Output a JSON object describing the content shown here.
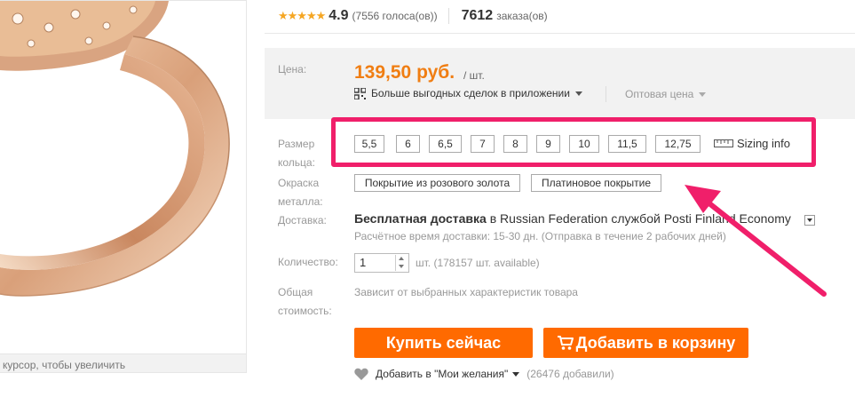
{
  "product_image": {
    "zoom_hint": "курсор, чтобы увеличить"
  },
  "rating": {
    "stars_glyph": "★★★★★",
    "value": "4.9",
    "votes": "(7556 голоса(ов))",
    "orders_count": "7612",
    "orders_label": "заказа(ов)"
  },
  "price": {
    "label": "Цена:",
    "value": "139,50 руб.",
    "unit": "/ шт.",
    "app_deals": "Больше выгодных сделок в приложении",
    "wholesale": "Оптовая цена"
  },
  "ring_size": {
    "label_line1": "Размер",
    "label_line2": "кольца:",
    "sizes": [
      "5,5",
      "6",
      "6,5",
      "7",
      "8",
      "9",
      "10",
      "11,5",
      "12,75"
    ],
    "sizing_info": "Sizing info"
  },
  "metal_color": {
    "label_line1": "Окраска",
    "label_line2": "металла:",
    "options": [
      "Покрытие из розового золота",
      "Платиновое покрытие"
    ]
  },
  "delivery": {
    "label": "Доставка:",
    "free": "Бесплатная доставка",
    "rest": " в  Russian Federation службой Posti Finland Economy",
    "estimate": "Расчётное время доставки: 15-30 дн. (Отправка в течение 2 рабочих дней)"
  },
  "quantity": {
    "label": "Количество:",
    "value": "1",
    "available": "шт. (178157 шт. available)"
  },
  "total": {
    "label_line1": "Общая",
    "label_line2": "стоимость:",
    "text": "Зависит от выбранных характеристик товара"
  },
  "buttons": {
    "buy": "Купить сейчас",
    "cart": "Добавить в корзину"
  },
  "wishlist": {
    "label": "Добавить в \"Мои желания\"",
    "count": "(26476 добавили)"
  },
  "colors": {
    "accent": "#ff6a00",
    "price": "#f07e13",
    "highlight": "#f01f6a",
    "stars": "#f5a623"
  }
}
